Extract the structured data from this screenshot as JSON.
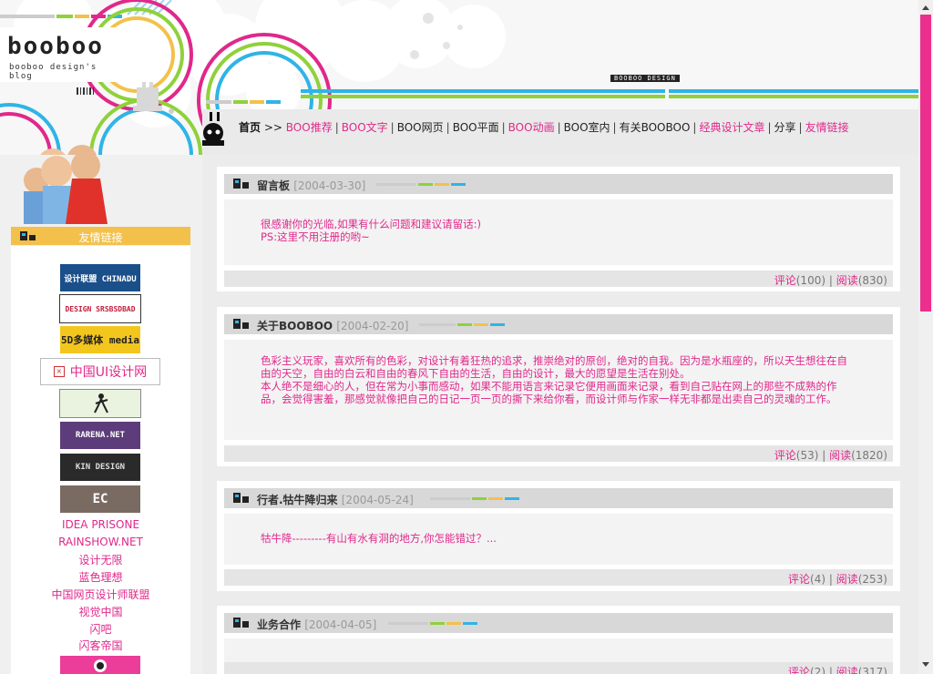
{
  "site": {
    "logo_text": "booboo",
    "logo_sub": "booboo design's blog",
    "brand_tag": "BOOBOO DESIGN"
  },
  "nav": {
    "items": [
      {
        "label": "首页",
        "style": "home"
      },
      {
        "label": ">>",
        "style": "dark"
      },
      {
        "label": "BOO推荐",
        "style": "pink"
      },
      {
        "label": "BOO文字",
        "style": "pink"
      },
      {
        "label": "BOO网页",
        "style": "dark"
      },
      {
        "label": "BOO平面",
        "style": "dark"
      },
      {
        "label": "BOO动画",
        "style": "pink"
      },
      {
        "label": "BOO室内",
        "style": "dark"
      },
      {
        "label": "有关BOOBOO",
        "style": "dark"
      },
      {
        "label": "经典设计文章",
        "style": "pink"
      },
      {
        "label": "分享",
        "style": "dark"
      },
      {
        "label": "友情链接",
        "style": "pink"
      }
    ]
  },
  "sidebar": {
    "header": "友情链接",
    "logo_links": [
      {
        "label": "设计联盟 CHINADU"
      },
      {
        "label": "DESIGN SRSBSDBAD"
      },
      {
        "label": "5D多媒体 media"
      },
      {
        "label": "中国UI设计网"
      },
      {
        "label": "runner"
      },
      {
        "label": "RARENA.NET"
      },
      {
        "label": "KIN DESIGN"
      },
      {
        "label": "EC"
      }
    ],
    "text_links": [
      "IDEA PRISONE",
      "RAINSHOW.NET",
      "设计无限",
      "蓝色理想",
      "中国网页设计师联盟",
      "视觉中国",
      "闪吧",
      "闪客帝国"
    ]
  },
  "posts": [
    {
      "title": "留言板",
      "date": "[2004-03-30]",
      "lines": [
        "很感谢你的光临,如果有什么问题和建议请留话:)",
        "PS:这里不用注册的哟~"
      ],
      "comments_label": "评论",
      "comments": "(100)",
      "reads_label": "阅读",
      "reads": "(830)"
    },
    {
      "title": "关于BOOBOO",
      "date": "[2004-02-20]",
      "lines": [
        "色彩主义玩家，喜欢所有的色彩，对设计有着狂热的追求，推崇绝对的原创，绝对的自我。因为是水瓶座的，所以天生想往在自由的天空，自由的白云和自由的春风下自由的生活，自由的设计，最大的愿望是生活在别处。",
        "本人绝不是细心的人，但在常为小事而感动，如果不能用语言来记录它便用画面来记录，看到自己贴在网上的那些不成熟的作品，会觉得害羞，那感觉就像把自己的日记一页一页的撕下来给你看，而设计师与作家一样无非都是出卖自己的灵魂的工作。"
      ],
      "comments_label": "评论",
      "comments": "(53)",
      "reads_label": "阅读",
      "reads": "(1820)"
    },
    {
      "title": "行者.牯牛降归来",
      "date": "[2004-05-24]",
      "lines": [
        "牯牛降---------有山有水有洞的地方,你怎能错过？..."
      ],
      "comments_label": "评论",
      "comments": "(4)",
      "reads_label": "阅读",
      "reads": "(253)"
    },
    {
      "title": "业务合作",
      "date": "[2004-04-05]",
      "lines": [],
      "comments_label": "评论",
      "comments": "(2)",
      "reads_label": "阅读",
      "reads": "(317)"
    }
  ],
  "colors": {
    "accent_pink": "#e0288b",
    "green": "#8fd13b",
    "yellow": "#f3c14b",
    "blue": "#2fb4e6"
  }
}
